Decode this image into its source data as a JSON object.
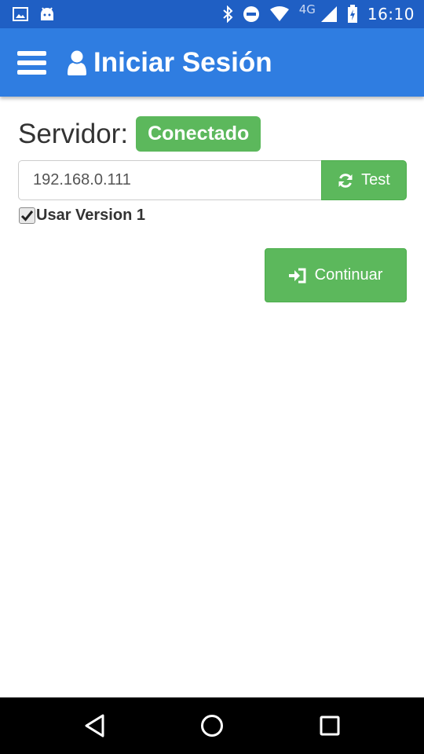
{
  "status_bar": {
    "time": "16:10",
    "network": "4G",
    "icons": [
      "gallery-icon",
      "android-icon",
      "bluetooth-icon",
      "do-not-disturb-icon",
      "wifi-icon",
      "cell-signal-icon",
      "battery-charging-icon"
    ]
  },
  "app_bar": {
    "title": "Iniciar Sesión",
    "menu_icon": "hamburger-menu-icon",
    "title_icon": "user-icon"
  },
  "server": {
    "label": "Servidor:",
    "status": "Conectado",
    "address": "192.168.0.111",
    "test_label": "Test",
    "test_icon": "refresh-icon"
  },
  "options": {
    "use_v1_label": "Usar Version 1",
    "use_v1_checked": true
  },
  "actions": {
    "continue_label": "Continuar",
    "continue_icon": "sign-in-icon"
  },
  "nav_bar": {
    "icons": [
      "back-icon",
      "home-icon",
      "recents-icon"
    ]
  },
  "colors": {
    "status_bar": "#1f5fc4",
    "app_bar": "#2f7de1",
    "success": "#5cb85c"
  }
}
